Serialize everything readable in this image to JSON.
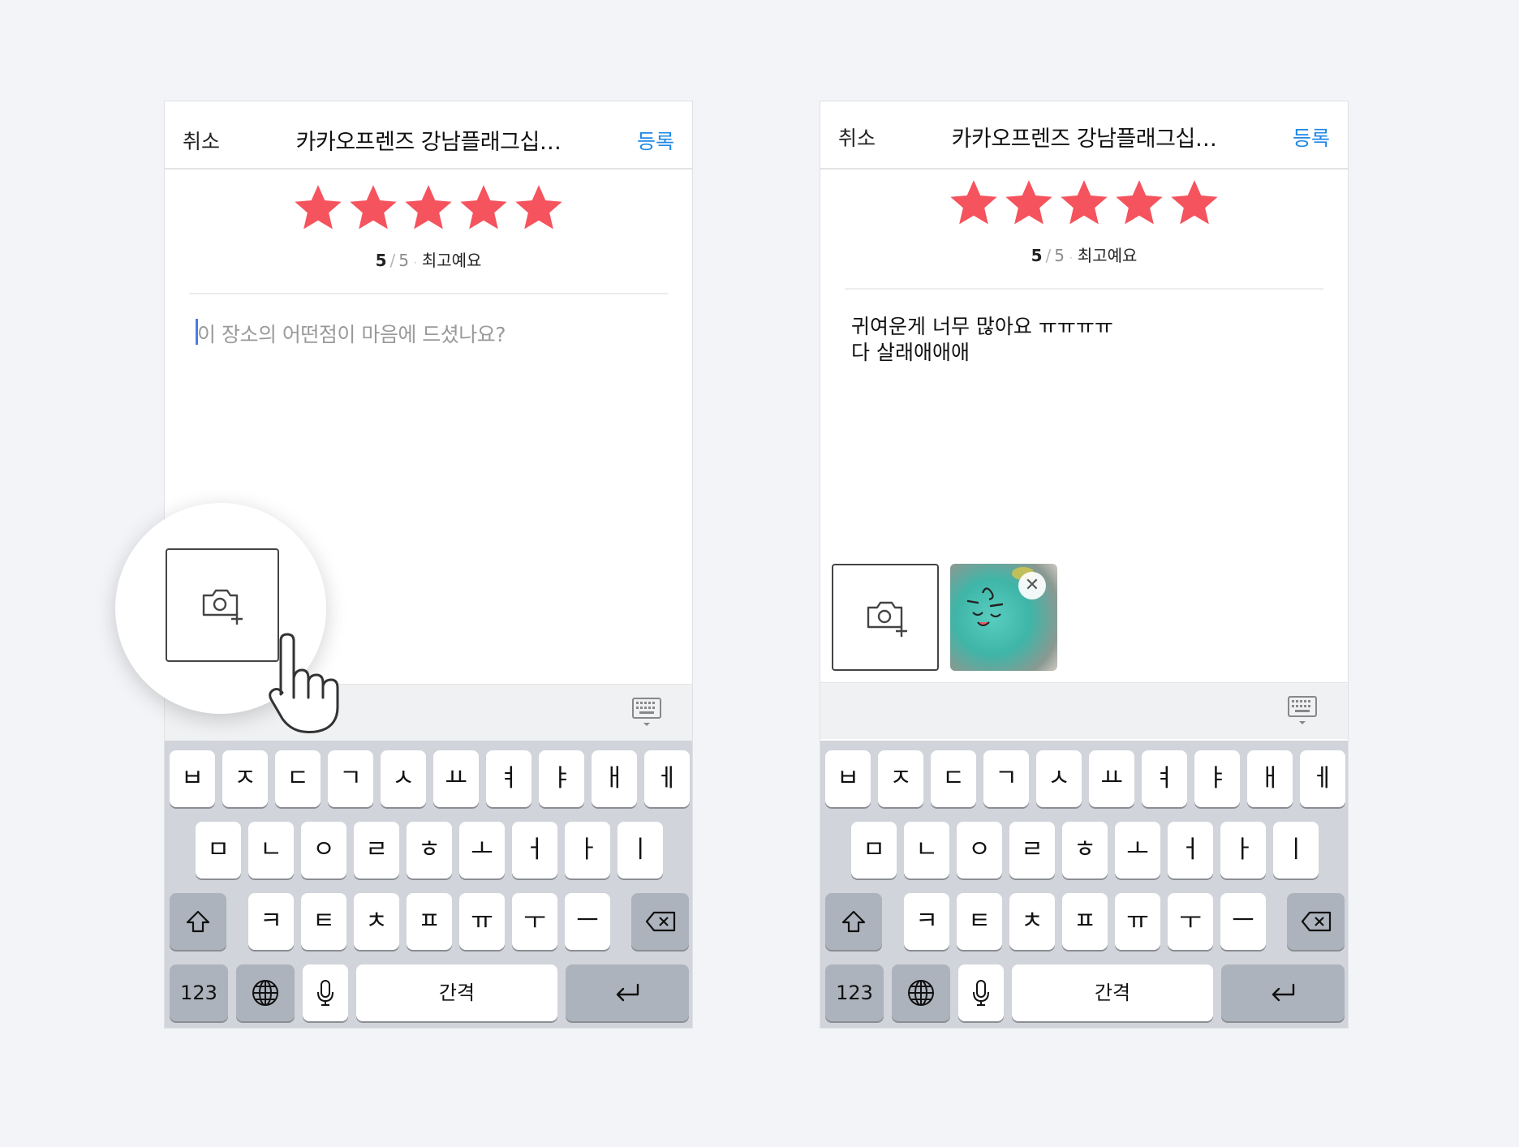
{
  "screens": [
    {
      "nav": {
        "cancel": "취소",
        "title": "카카오프렌즈 강남플래그십…",
        "submit": "등록"
      },
      "rating": {
        "score": "5",
        "separator": "/",
        "total": "5",
        "dot": "·",
        "description": "최고예요",
        "stars_filled": 5,
        "stars_total": 5
      },
      "review": {
        "placeholder": "이 장소의 어떤점이 마음에 드셨나요?"
      }
    },
    {
      "nav": {
        "cancel": "취소",
        "title": "카카오프렌즈 강남플래그십…",
        "submit": "등록"
      },
      "rating": {
        "score": "5",
        "separator": "/",
        "total": "5",
        "dot": "·",
        "description": "최고예요",
        "stars_filled": 5,
        "stars_total": 5
      },
      "review": {
        "line1": "귀여운게 너무 많아요 ㅠㅠㅠㅠ",
        "line2": "다 살래애애애"
      }
    }
  ],
  "keyboard": {
    "row1": [
      "ㅂ",
      "ㅈ",
      "ㄷ",
      "ㄱ",
      "ㅅ",
      "ㅛ",
      "ㅕ",
      "ㅑ",
      "ㅐ",
      "ㅔ"
    ],
    "row2": [
      "ㅁ",
      "ㄴ",
      "ㅇ",
      "ㄹ",
      "ㅎ",
      "ㅗ",
      "ㅓ",
      "ㅏ",
      "ㅣ"
    ],
    "row3": [
      "ㅋ",
      "ㅌ",
      "ㅊ",
      "ㅍ",
      "ㅠ",
      "ㅜ",
      "ㅡ"
    ],
    "numbers": "123",
    "space": "간격"
  },
  "icons": {
    "star": "star-icon",
    "camera": "camera-plus-icon",
    "keyboard_toggle": "keyboard-dismiss-icon",
    "shift": "shift-icon",
    "delete": "backspace-icon",
    "globe": "globe-icon",
    "mic": "microphone-icon",
    "return": "return-icon",
    "remove": "close-icon",
    "hand": "tap-hand-icon"
  },
  "colors": {
    "star": "#f5535d",
    "accent": "#1f88e6",
    "caret": "#4a7be8",
    "keyboard_bg": "#d1d4da",
    "function_key": "#adb3bc"
  }
}
